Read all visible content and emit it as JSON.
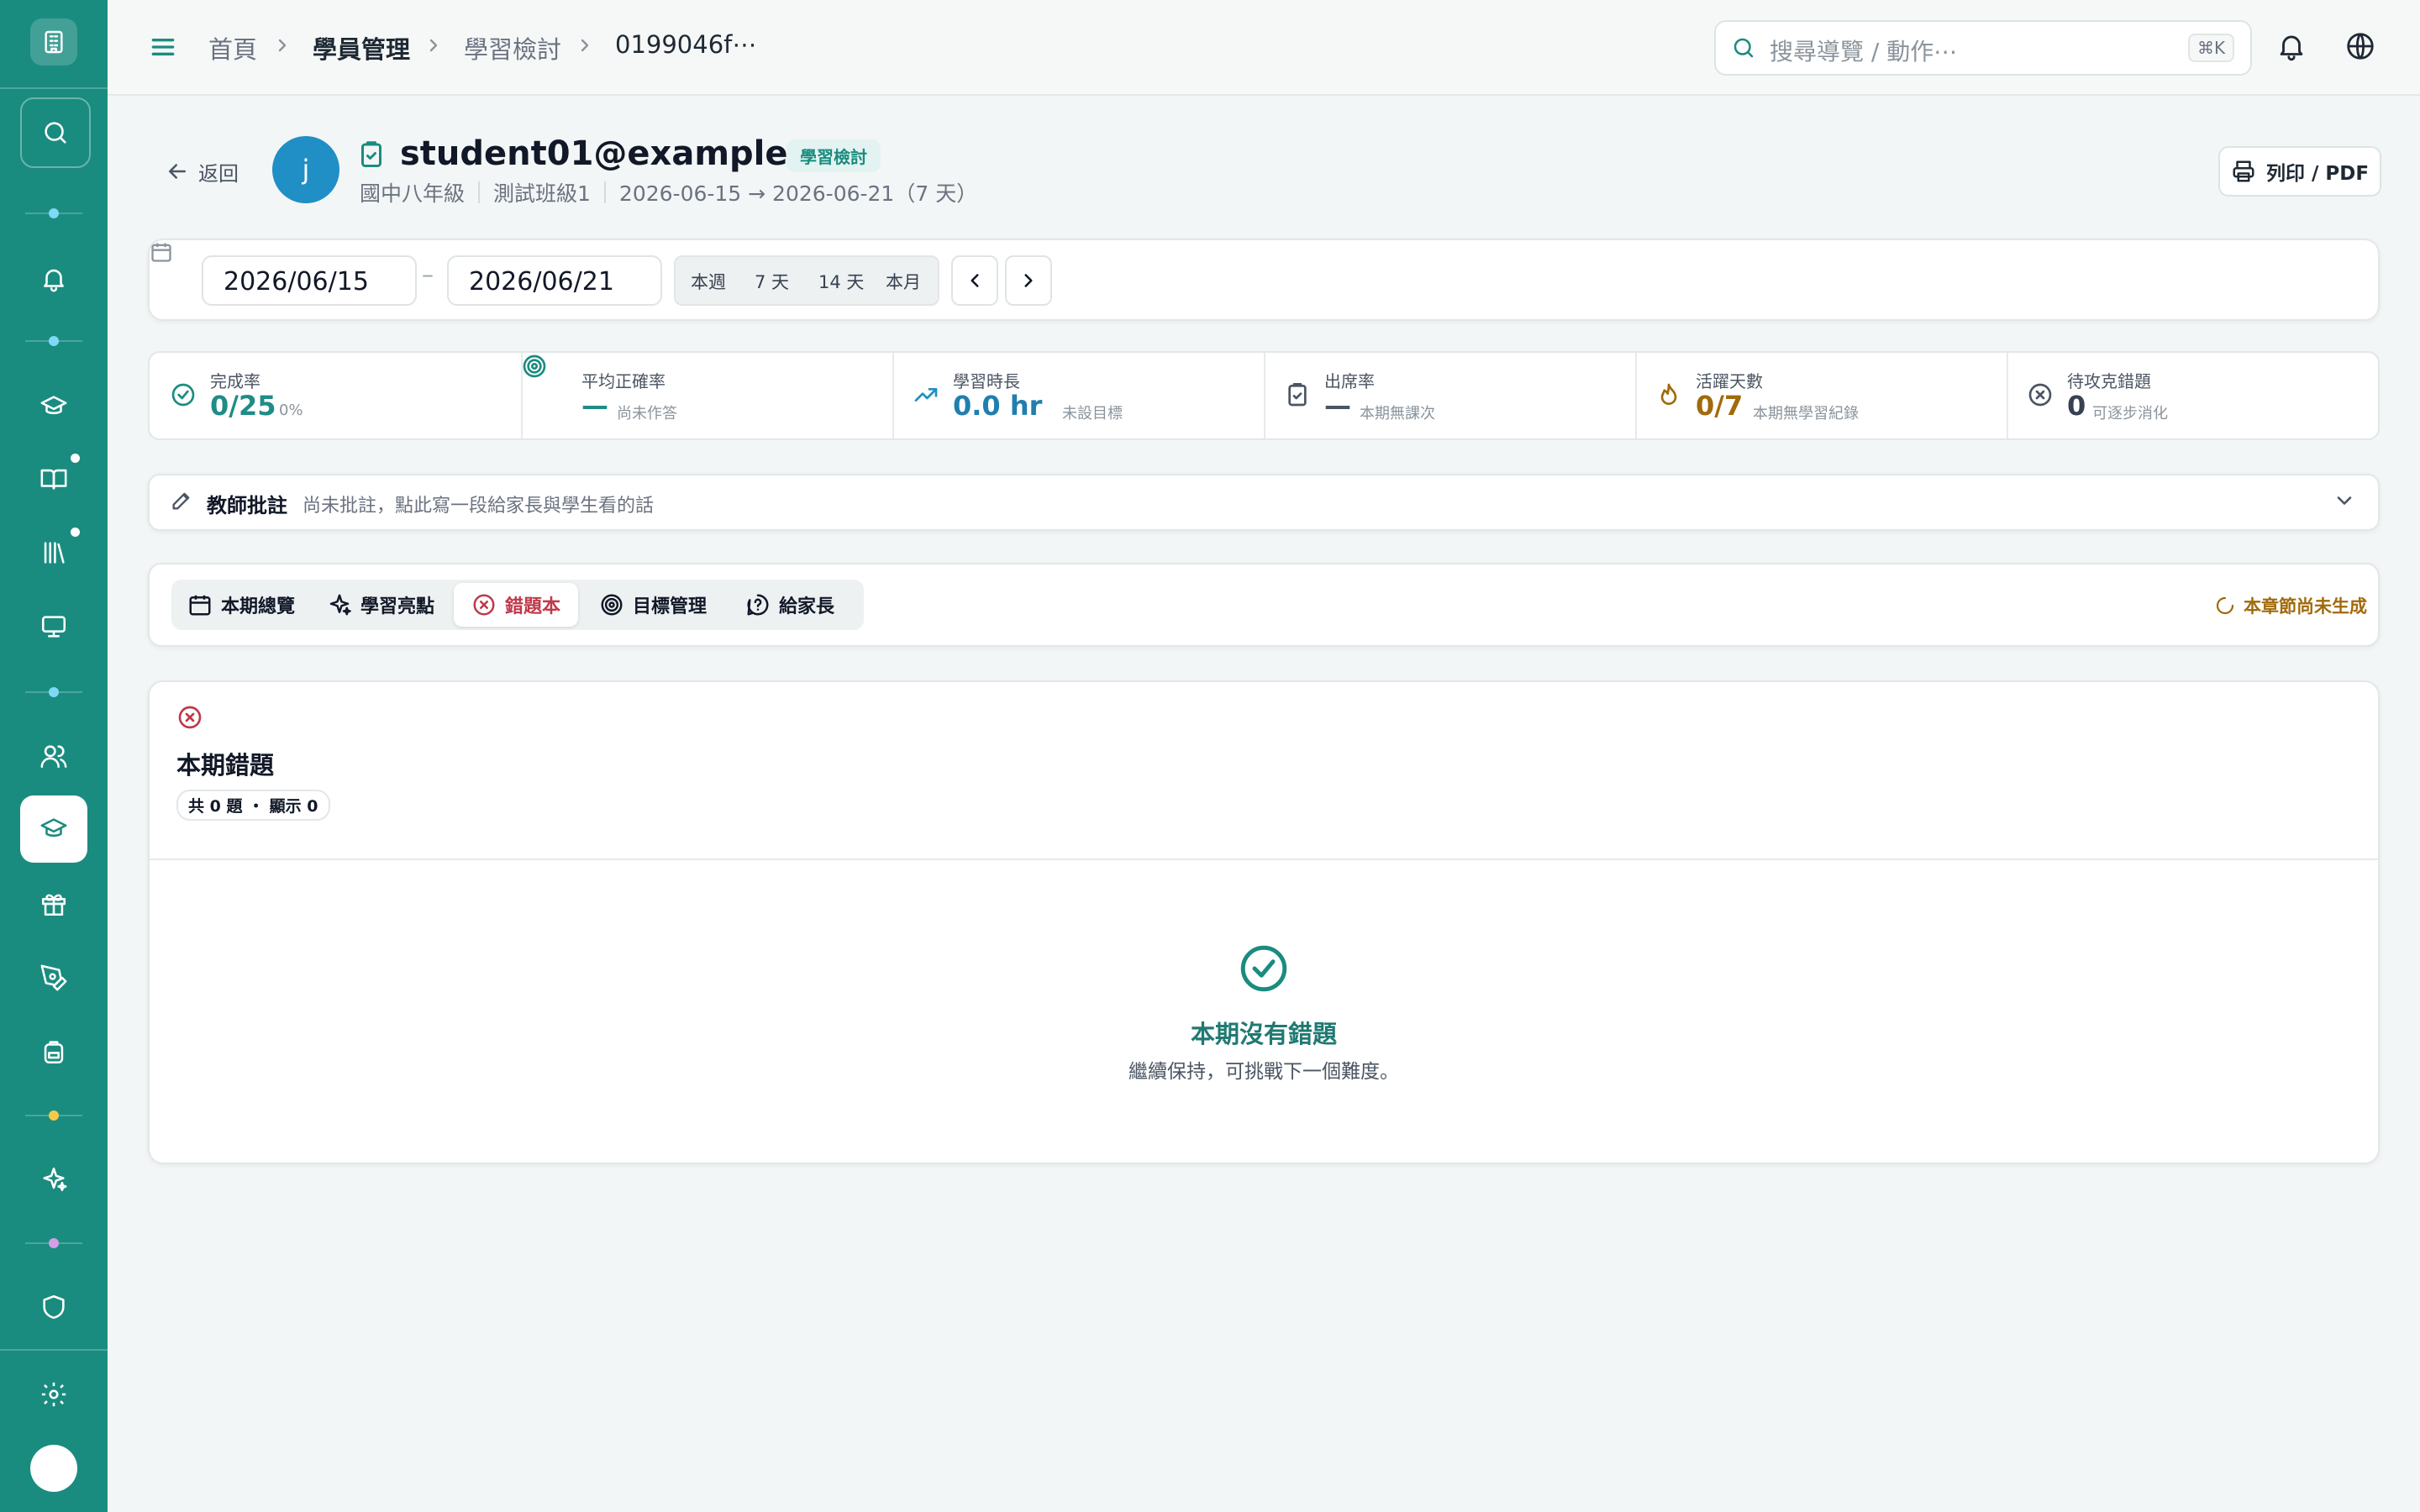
{
  "breadcrumb": {
    "home": "首頁",
    "section": "學員管理",
    "page": "學習檢討",
    "id": "0199046f⋯"
  },
  "search": {
    "placeholder": "搜尋導覽 / 動作⋯",
    "shortcut": "⌘K"
  },
  "header": {
    "back_label": "返回",
    "avatar_letter": "j",
    "email": "student01@example.test",
    "tag": "學習檢討",
    "grade": "國中八年級",
    "class_name": "測試班級1",
    "period": "2026-06-15 → 2026-06-21（7 天）",
    "print_label": "列印 / PDF"
  },
  "date_range": {
    "start": "2026/06/15",
    "end": "2026/06/21",
    "presets": [
      "本週",
      "7 天",
      "14 天",
      "本月"
    ]
  },
  "stats": [
    {
      "label": "完成率",
      "value": "0/25",
      "sub": "0%",
      "icon": "check-circle-icon"
    },
    {
      "label": "平均正確率",
      "value": "—",
      "sub": "尚未作答",
      "icon": "target-icon"
    },
    {
      "label": "學習時長",
      "value": "0.0 hr",
      "sub": "未設目標",
      "icon": "trending-up-icon"
    },
    {
      "label": "出席率",
      "value": "—",
      "sub": "本期無課次",
      "icon": "clipboard-icon"
    },
    {
      "label": "活躍天數",
      "value": "0/7",
      "sub": "本期無學習紀錄",
      "icon": "flame-icon"
    },
    {
      "label": "待攻克錯題",
      "value": "0",
      "sub": "可逐步消化",
      "icon": "x-circle-icon"
    }
  ],
  "notes": {
    "title": "教師批註",
    "hint": "尚未批註，點此寫一段給家長與學生看的話"
  },
  "tabs": [
    {
      "label": "本期總覽",
      "icon": "calendar-icon"
    },
    {
      "label": "學習亮點",
      "icon": "sparkles-icon"
    },
    {
      "label": "錯題本",
      "icon": "x-circle-icon",
      "active": true
    },
    {
      "label": "目標管理",
      "icon": "target-icon"
    },
    {
      "label": "給家長",
      "icon": "help-circle-icon"
    }
  ],
  "generation_status": "本章節尚未生成",
  "mistakes": {
    "title": "本期錯題",
    "count_badge": "共 0 題 ・ 顯示 0",
    "empty_title": "本期沒有錯題",
    "empty_subtitle": "繼續保持，可挑戰下一個難度。"
  },
  "colors": {
    "brand": "#1a8c7f",
    "accent": "#1f8c86",
    "danger": "#c0394b",
    "warning": "#a16a0a",
    "avatar": "#1f8fc5"
  }
}
